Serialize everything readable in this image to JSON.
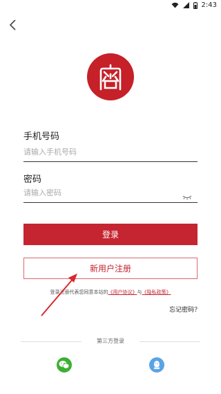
{
  "status_bar": {
    "time": "2:43"
  },
  "icons": {
    "back": "chevron-left-icon",
    "logo": "seal-logo",
    "eye": "eye-closed-icon",
    "wechat": "wechat-icon",
    "qq": "qq-icon"
  },
  "colors": {
    "brand": "#c52530",
    "wechat": "#3cb034",
    "qq": "#5aa4e6"
  },
  "form": {
    "phone_label": "手机号码",
    "phone_placeholder": "请输入手机号码",
    "password_label": "密码",
    "password_placeholder": "请输入密码"
  },
  "buttons": {
    "login": "登录",
    "register": "新用户注册"
  },
  "agreement": {
    "prefix": "登录注册代表您同意本站的",
    "user_agreement": "《用户协议》",
    "and": "与",
    "privacy_policy": "《隐私政策》"
  },
  "forgot_password": "忘记密码?",
  "third_party": {
    "title": "第三方登录"
  }
}
